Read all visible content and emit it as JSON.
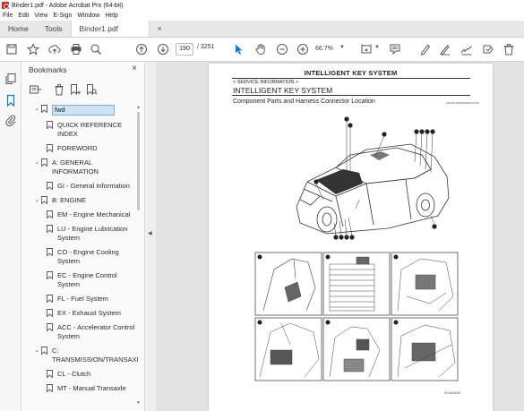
{
  "window": {
    "title": "Binder1.pdf - Adobe Acrobat Pro (64-bit)"
  },
  "menu": [
    "File",
    "Edit",
    "View",
    "E-Sign",
    "Window",
    "Help"
  ],
  "tabs": {
    "home": "Home",
    "tools": "Tools",
    "document": "Binder1.pdf",
    "close": "×"
  },
  "toolbar": {
    "page_current": "190",
    "page_total": "/ 3251",
    "zoom": "66.7%"
  },
  "bookmarks": {
    "header": "Bookmarks",
    "close": "×",
    "items": [
      {
        "label": "fwd",
        "level": 0,
        "chevron": "⌄",
        "selected": true
      },
      {
        "label": "QUICK REFERENCE INDEX",
        "level": 1
      },
      {
        "label": "FOREWORD",
        "level": 1
      },
      {
        "label": "A: GENERAL INFORMATION",
        "level": 0,
        "chevron": "⌄"
      },
      {
        "label": "GI - General Information",
        "level": 1
      },
      {
        "label": "B: ENGINE",
        "level": 0,
        "chevron": "⌄"
      },
      {
        "label": "EM - Engine Mechanical",
        "level": 1
      },
      {
        "label": "LU - Engine Lubrication System",
        "level": 1
      },
      {
        "label": "CO - Engine Cooling System",
        "level": 1
      },
      {
        "label": "EC - Engine Control System",
        "level": 1
      },
      {
        "label": "FL - Fuel System",
        "level": 1
      },
      {
        "label": "EX - Exhaust System",
        "level": 1
      },
      {
        "label": "ACC - Accelerator Control System",
        "level": 1
      },
      {
        "label": "C: TRANSMISSION/TRANSAXLE",
        "level": 0,
        "chevron": "⌄"
      },
      {
        "label": "CL - Clutch",
        "level": 1
      },
      {
        "label": "MT - Manual Transaxle",
        "level": 1
      }
    ]
  },
  "document": {
    "header": "INTELLIGENT KEY SYSTEM",
    "service_info": "< SERVICE INFORMATION >",
    "title": "INTELLIGENT KEY SYSTEM",
    "subtitle": "Component Parts and Harness Connector Location",
    "figure_code": "INFOID:0000000001497927",
    "footer_code": "SKIA6463E"
  },
  "colors": {
    "accent": "#1473e6",
    "acrobat_red": "#d4231c",
    "selection": "#cfe3f7"
  }
}
